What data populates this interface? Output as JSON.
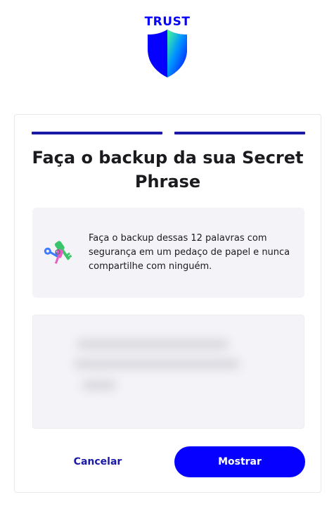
{
  "brand": {
    "wordmark": "TRUST",
    "primary_color": "#0500ff",
    "shield_gradient": [
      "#0500ff",
      "#48ff91"
    ]
  },
  "header": {
    "logo_icon": "trust-shield-icon"
  },
  "progress": {
    "steps_total": 2,
    "steps_completed": 2,
    "color": "#1a1aa6"
  },
  "card": {
    "title": "Faça o backup da sua Secret Phrase",
    "info": {
      "icon": "keys-icon",
      "text": "Faça o backup dessas 12 palavras com segurança em um pedaço de papel e nunca compartilhe com ninguém."
    },
    "phrase": {
      "state": "hidden"
    }
  },
  "actions": {
    "cancel_label": "Cancelar",
    "show_label": "Mostrar",
    "show_color": "#0500ff"
  }
}
